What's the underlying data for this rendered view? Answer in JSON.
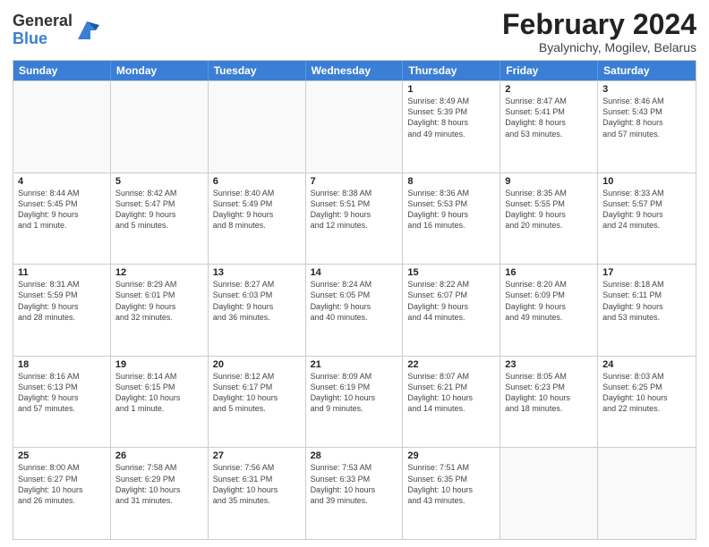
{
  "logo": {
    "general": "General",
    "blue": "Blue"
  },
  "header": {
    "month": "February 2024",
    "location": "Byalynichy, Mogilev, Belarus"
  },
  "weekdays": [
    "Sunday",
    "Monday",
    "Tuesday",
    "Wednesday",
    "Thursday",
    "Friday",
    "Saturday"
  ],
  "rows": [
    [
      {
        "day": "",
        "info": ""
      },
      {
        "day": "",
        "info": ""
      },
      {
        "day": "",
        "info": ""
      },
      {
        "day": "",
        "info": ""
      },
      {
        "day": "1",
        "info": "Sunrise: 8:49 AM\nSunset: 5:39 PM\nDaylight: 8 hours\nand 49 minutes."
      },
      {
        "day": "2",
        "info": "Sunrise: 8:47 AM\nSunset: 5:41 PM\nDaylight: 8 hours\nand 53 minutes."
      },
      {
        "day": "3",
        "info": "Sunrise: 8:46 AM\nSunset: 5:43 PM\nDaylight: 8 hours\nand 57 minutes."
      }
    ],
    [
      {
        "day": "4",
        "info": "Sunrise: 8:44 AM\nSunset: 5:45 PM\nDaylight: 9 hours\nand 1 minute."
      },
      {
        "day": "5",
        "info": "Sunrise: 8:42 AM\nSunset: 5:47 PM\nDaylight: 9 hours\nand 5 minutes."
      },
      {
        "day": "6",
        "info": "Sunrise: 8:40 AM\nSunset: 5:49 PM\nDaylight: 9 hours\nand 8 minutes."
      },
      {
        "day": "7",
        "info": "Sunrise: 8:38 AM\nSunset: 5:51 PM\nDaylight: 9 hours\nand 12 minutes."
      },
      {
        "day": "8",
        "info": "Sunrise: 8:36 AM\nSunset: 5:53 PM\nDaylight: 9 hours\nand 16 minutes."
      },
      {
        "day": "9",
        "info": "Sunrise: 8:35 AM\nSunset: 5:55 PM\nDaylight: 9 hours\nand 20 minutes."
      },
      {
        "day": "10",
        "info": "Sunrise: 8:33 AM\nSunset: 5:57 PM\nDaylight: 9 hours\nand 24 minutes."
      }
    ],
    [
      {
        "day": "11",
        "info": "Sunrise: 8:31 AM\nSunset: 5:59 PM\nDaylight: 9 hours\nand 28 minutes."
      },
      {
        "day": "12",
        "info": "Sunrise: 8:29 AM\nSunset: 6:01 PM\nDaylight: 9 hours\nand 32 minutes."
      },
      {
        "day": "13",
        "info": "Sunrise: 8:27 AM\nSunset: 6:03 PM\nDaylight: 9 hours\nand 36 minutes."
      },
      {
        "day": "14",
        "info": "Sunrise: 8:24 AM\nSunset: 6:05 PM\nDaylight: 9 hours\nand 40 minutes."
      },
      {
        "day": "15",
        "info": "Sunrise: 8:22 AM\nSunset: 6:07 PM\nDaylight: 9 hours\nand 44 minutes."
      },
      {
        "day": "16",
        "info": "Sunrise: 8:20 AM\nSunset: 6:09 PM\nDaylight: 9 hours\nand 49 minutes."
      },
      {
        "day": "17",
        "info": "Sunrise: 8:18 AM\nSunset: 6:11 PM\nDaylight: 9 hours\nand 53 minutes."
      }
    ],
    [
      {
        "day": "18",
        "info": "Sunrise: 8:16 AM\nSunset: 6:13 PM\nDaylight: 9 hours\nand 57 minutes."
      },
      {
        "day": "19",
        "info": "Sunrise: 8:14 AM\nSunset: 6:15 PM\nDaylight: 10 hours\nand 1 minute."
      },
      {
        "day": "20",
        "info": "Sunrise: 8:12 AM\nSunset: 6:17 PM\nDaylight: 10 hours\nand 5 minutes."
      },
      {
        "day": "21",
        "info": "Sunrise: 8:09 AM\nSunset: 6:19 PM\nDaylight: 10 hours\nand 9 minutes."
      },
      {
        "day": "22",
        "info": "Sunrise: 8:07 AM\nSunset: 6:21 PM\nDaylight: 10 hours\nand 14 minutes."
      },
      {
        "day": "23",
        "info": "Sunrise: 8:05 AM\nSunset: 6:23 PM\nDaylight: 10 hours\nand 18 minutes."
      },
      {
        "day": "24",
        "info": "Sunrise: 8:03 AM\nSunset: 6:25 PM\nDaylight: 10 hours\nand 22 minutes."
      }
    ],
    [
      {
        "day": "25",
        "info": "Sunrise: 8:00 AM\nSunset: 6:27 PM\nDaylight: 10 hours\nand 26 minutes."
      },
      {
        "day": "26",
        "info": "Sunrise: 7:58 AM\nSunset: 6:29 PM\nDaylight: 10 hours\nand 31 minutes."
      },
      {
        "day": "27",
        "info": "Sunrise: 7:56 AM\nSunset: 6:31 PM\nDaylight: 10 hours\nand 35 minutes."
      },
      {
        "day": "28",
        "info": "Sunrise: 7:53 AM\nSunset: 6:33 PM\nDaylight: 10 hours\nand 39 minutes."
      },
      {
        "day": "29",
        "info": "Sunrise: 7:51 AM\nSunset: 6:35 PM\nDaylight: 10 hours\nand 43 minutes."
      },
      {
        "day": "",
        "info": ""
      },
      {
        "day": "",
        "info": ""
      }
    ]
  ]
}
